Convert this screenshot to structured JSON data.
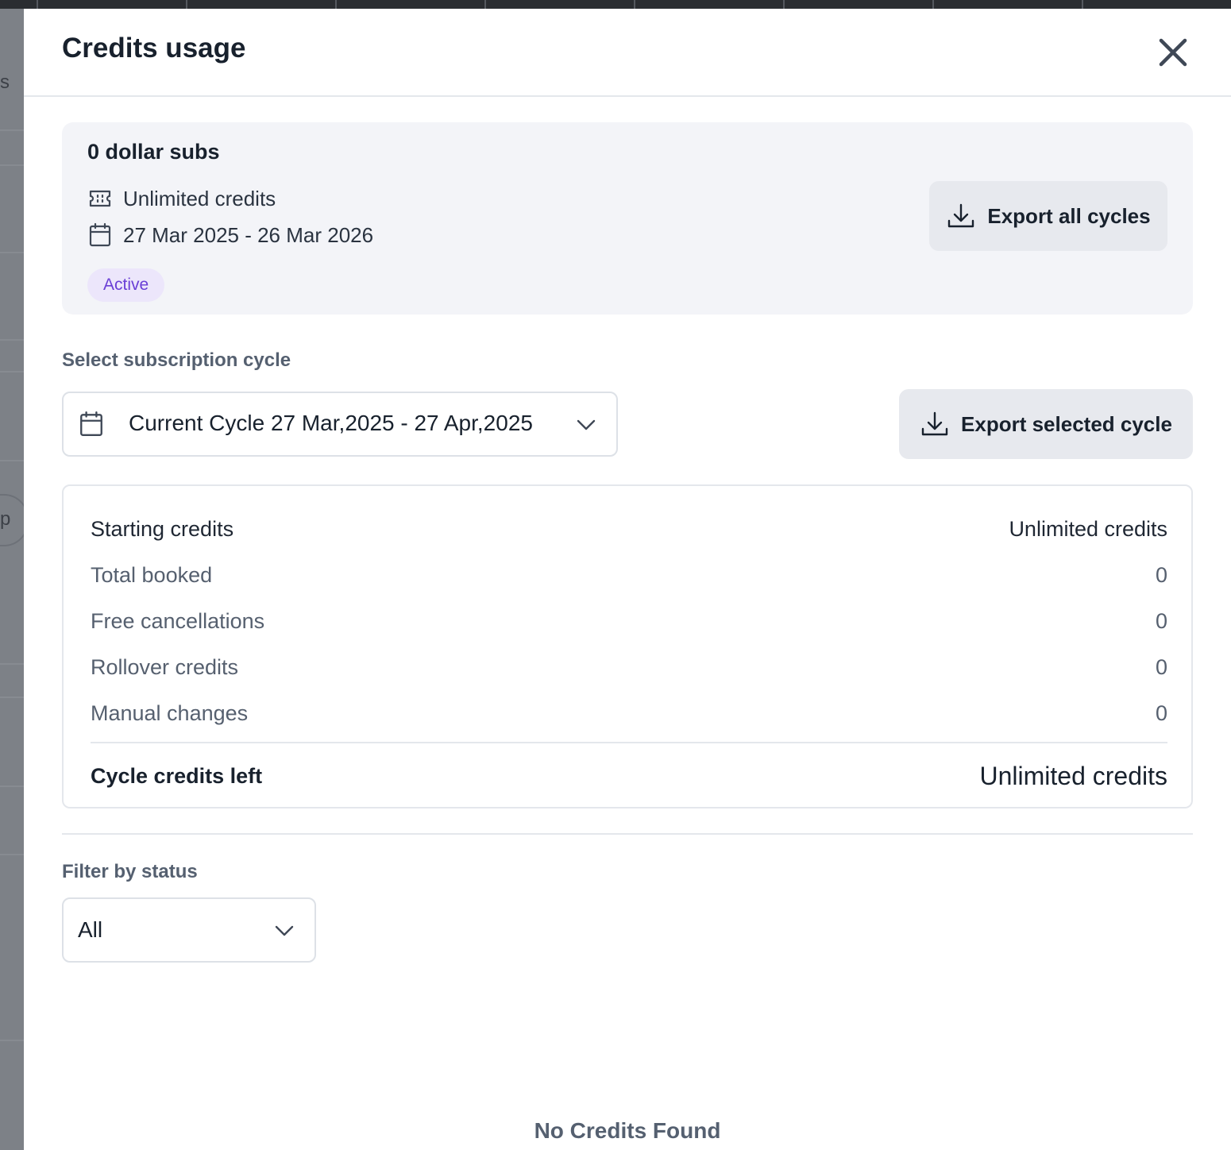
{
  "drawer": {
    "title": "Credits usage"
  },
  "background": {
    "letters": [
      "s",
      "p"
    ]
  },
  "subscription": {
    "name": "0 dollar subs",
    "credits_text": "Unlimited credits",
    "date_range": "27 Mar 2025 - 26 Mar 2026",
    "status": "Active",
    "export_all_label": "Export all cycles"
  },
  "cycle": {
    "section_label": "Select subscription cycle",
    "selected_value": "Current Cycle 27 Mar,2025 - 27 Apr,2025",
    "export_selected_label": "Export selected cycle"
  },
  "credits": {
    "rows": [
      {
        "label": "Starting credits",
        "value": "Unlimited credits"
      },
      {
        "label": "Total booked",
        "value": "0"
      },
      {
        "label": "Free cancellations",
        "value": "0"
      },
      {
        "label": "Rollover credits",
        "value": "0"
      },
      {
        "label": "Manual changes",
        "value": "0"
      }
    ],
    "total": {
      "label": "Cycle credits left",
      "value": "Unlimited credits"
    }
  },
  "filter": {
    "section_label": "Filter by status",
    "selected_value": "All"
  },
  "empty_state": "No Credits Found",
  "colors": {
    "badge_text": "#6a3fd6",
    "badge_bg": "#ece6fb",
    "button_bg": "#e7e9ee",
    "summary_bg": "#f3f4f8"
  },
  "icons": [
    "close-icon",
    "ticket-icon",
    "calendar-icon",
    "download-icon",
    "chevron-down-icon"
  ]
}
